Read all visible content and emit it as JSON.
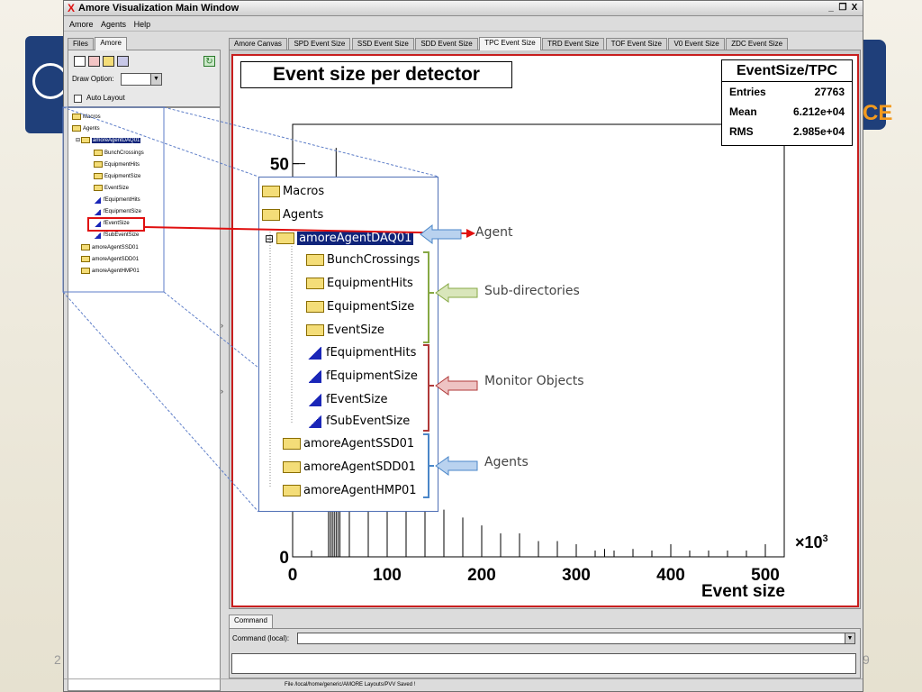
{
  "window": {
    "title": "Amore Visualization Main Window",
    "x_logo": "X",
    "minimize": "_",
    "maximize": "Δ",
    "close": "X"
  },
  "menu": {
    "amore": "Amore",
    "agents": "Agents",
    "help": "Help"
  },
  "left_tabs": [
    "Files",
    "Amore"
  ],
  "left_panel": {
    "draw_option_label": "Draw Option:",
    "auto_layout_label": "Auto Layout"
  },
  "tree": {
    "macros": "Macros",
    "agents": "Agents",
    "agent_daq": "amoreAgentDAQ01",
    "bunch": "BunchCrossings",
    "equip_hits": "EquipmentHits",
    "equip_size": "EquipmentSize",
    "event_size": "EventSize",
    "f_equip_hits": "fEquipmentHits",
    "f_equip_size": "fEquipmentSize",
    "f_event_size": "fEventSize",
    "f_sub_event_size": "fSubEventSize",
    "agent_ssd": "amoreAgentSSD01",
    "agent_sdd": "amoreAgentSDD01",
    "agent_hmp": "amoreAgentHMP01"
  },
  "main_tabs": [
    "Amore Canvas",
    "SPD Event Size",
    "SSD Event Size",
    "SDD Event Size",
    "TPC Event Size",
    "TRD Event Size",
    "TOF Event Size",
    "V0 Event Size",
    "ZDC Event Size"
  ],
  "chart_data": {
    "type": "bar",
    "title": "Event size per detector",
    "xlabel": "Event size",
    "x_multiplier": "×10",
    "x_multiplier_exp": "3",
    "xlim": [
      0,
      520
    ],
    "ylim": [
      0,
      55
    ],
    "xticks": [
      "0",
      "100",
      "200",
      "300",
      "400",
      "500"
    ],
    "yticks": [
      "0",
      "50"
    ],
    "stats": {
      "title": "EventSize/TPC",
      "entries_label": "Entries",
      "entries": "27763",
      "mean_label": "Mean",
      "mean": "6.212e+04",
      "rms_label": "RMS",
      "rms": "2.985e+04"
    },
    "x": [
      38,
      40,
      42,
      44,
      46,
      48,
      50,
      60,
      80,
      100,
      120,
      140,
      160,
      180,
      200,
      220,
      240,
      260,
      280,
      300,
      330,
      360
    ],
    "values": [
      20,
      47,
      44,
      28,
      52,
      35,
      24,
      22,
      18,
      14,
      11,
      8,
      6,
      5,
      4,
      3,
      3,
      2,
      2,
      1,
      1,
      1
    ]
  },
  "command": {
    "tab": "Command",
    "label": "Command (local):",
    "dropdown": "▼"
  },
  "status": {
    "text": "File /local/home/generic/AMORE Layouts/PVV Saved !"
  },
  "annotations": {
    "agent": "Agent",
    "subdirs": "Sub-directories",
    "monitor": "Monitor Objects",
    "agents": "Agents"
  },
  "slide": {
    "page_left": "2",
    "page_right": "9",
    "logo_right": "CE"
  },
  "colors": {
    "selection": "#10247a",
    "highlight_red": "#e01010",
    "bracket_green": "#86a844",
    "bracket_red": "#b03a3a",
    "bracket_blue": "#4a86c8"
  }
}
